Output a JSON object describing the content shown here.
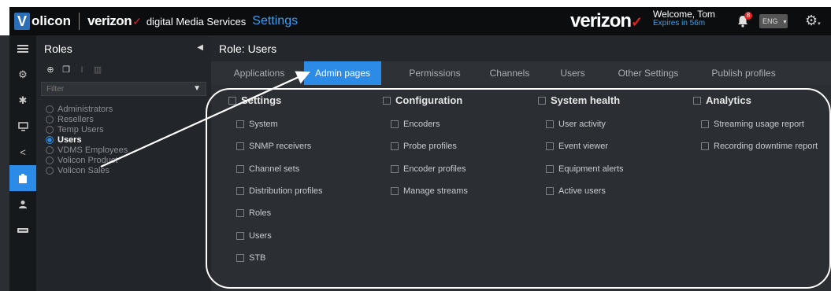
{
  "header": {
    "logo_letter": "V",
    "logo_text": "olicon",
    "brand_small": "verizon",
    "brand_subtitle": "digital Media Services",
    "section_title": "Settings",
    "brand_big": "verizon",
    "welcome": "Welcome, Tom",
    "expires": "Expires in 56m",
    "notification_count": "8",
    "language": "ENG"
  },
  "rail": {
    "items": [
      "menu-icon",
      "gear-icon",
      "puzzle-icon",
      "monitor-icon",
      "share-icon",
      "clipboard-icon",
      "user-icon",
      "card-icon"
    ],
    "active_index": 5
  },
  "roles": {
    "title": "Roles",
    "filter_placeholder": "Filter",
    "items": [
      {
        "label": "Administrators",
        "selected": false
      },
      {
        "label": "Resellers",
        "selected": false
      },
      {
        "label": "Temp Users",
        "selected": false
      },
      {
        "label": "Users",
        "selected": true
      },
      {
        "label": "VDMS Employees",
        "selected": false
      },
      {
        "label": "Volicon Product",
        "selected": false
      },
      {
        "label": "Volicon Sales",
        "selected": false
      }
    ]
  },
  "main": {
    "title": "Role: Users",
    "tabs": [
      "Applications",
      "Admin pages",
      "Permissions",
      "Channels",
      "Users",
      "Other Settings",
      "Publish profiles"
    ],
    "active_tab": "Admin pages",
    "columns": [
      {
        "title": "Settings",
        "items": [
          "System",
          "SNMP receivers",
          "Channel sets",
          "Distribution profiles",
          "Roles",
          "Users",
          "STB"
        ]
      },
      {
        "title": "Configuration",
        "items": [
          "Encoders",
          "Probe profiles",
          "Encoder profiles",
          "Manage streams"
        ]
      },
      {
        "title": "System health",
        "items": [
          "User activity",
          "Event viewer",
          "Equipment alerts",
          "Active users"
        ]
      },
      {
        "title": "Analytics",
        "items": [
          "Streaming usage report",
          "Recording downtime report"
        ]
      }
    ]
  },
  "colors": {
    "accent": "#2b8be6",
    "brand_red": "#e32222",
    "link_blue": "#3a9ff0"
  }
}
